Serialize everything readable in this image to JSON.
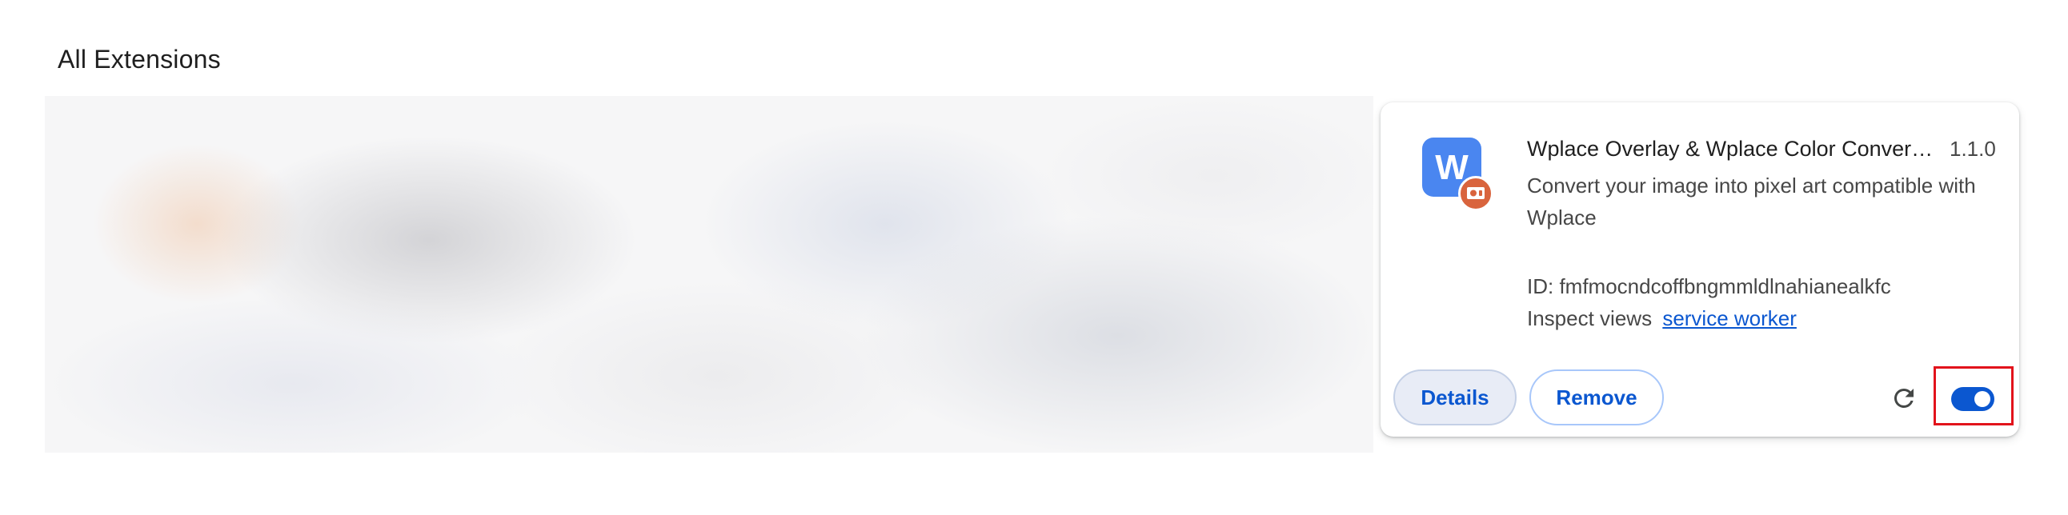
{
  "section": {
    "title": "All Extensions"
  },
  "extension": {
    "name": "Wplace Overlay & Wplace Color Convert...",
    "version": "1.1.0",
    "description": "Convert your image into pixel art compatible with Wplace",
    "id_text": "ID: fmfmocndcoffbngmmldlnahianealkfc",
    "inspect_label": "Inspect views",
    "inspect_link": "service worker",
    "icon": "wplace-logo-icon",
    "badge_icon": "policy-badge-icon",
    "enabled": true
  },
  "actions": {
    "details_label": "Details",
    "remove_label": "Remove",
    "reload_icon": "reload-icon",
    "toggle_icon": "enable-toggle"
  },
  "colors": {
    "accent": "#0b57d0",
    "icon_bg": "#4a86f0",
    "badge": "#d9643d",
    "highlight": "#e2131b"
  }
}
